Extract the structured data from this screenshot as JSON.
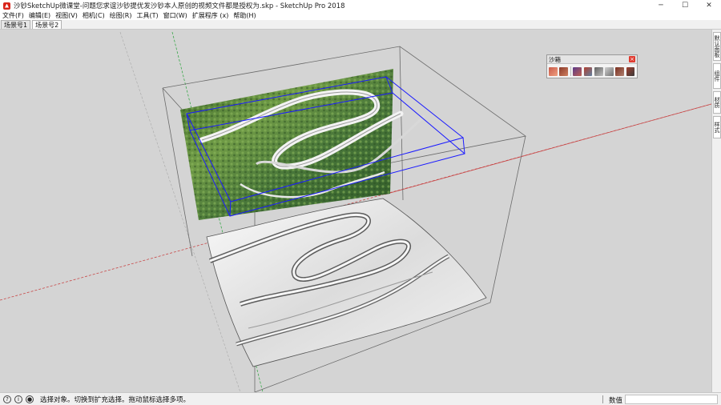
{
  "window": {
    "title": "沙钞SketchUp微课堂-问题您求谊沙钞提优发沙钞本人原创的视频文件都是授权为.skp - SketchUp Pro 2018",
    "minimize": "─",
    "maximize": "☐",
    "close": "✕"
  },
  "menu": [
    {
      "label": "文件(F)"
    },
    {
      "label": "编辑(E)"
    },
    {
      "label": "视图(V)"
    },
    {
      "label": "相机(C)"
    },
    {
      "label": "绘图(R)"
    },
    {
      "label": "工具(T)"
    },
    {
      "label": "窗口(W)"
    },
    {
      "label": "扩展程序 (x)"
    },
    {
      "label": "帮助(H)"
    }
  ],
  "scenes": [
    {
      "label": "场景号1",
      "active": false
    },
    {
      "label": "场景号2",
      "active": true
    }
  ],
  "right_tray": [
    {
      "label": "默认面板"
    },
    {
      "label": "组件"
    },
    {
      "label": "材质"
    },
    {
      "label": "样式"
    }
  ],
  "sandbox_toolbar": {
    "title": "沙箱",
    "close": "×",
    "tools": [
      {
        "icon": "sandbox-from-contours-icon"
      },
      {
        "icon": "sandbox-from-scratch-icon"
      },
      {
        "icon": "smoove-icon"
      },
      {
        "icon": "stamp-icon"
      },
      {
        "icon": "drape-icon"
      },
      {
        "icon": "add-detail-icon"
      },
      {
        "icon": "flip-edge-icon"
      },
      {
        "icon": "unknown-sandbox-tool-icon"
      }
    ]
  },
  "statusbar": {
    "hint": "选择对象。切换到扩充选择。拖动鼠标选择多项。",
    "vcb_label": "数值",
    "vcb_value": ""
  },
  "colors": {
    "viewport_bg": "#d4d4d4",
    "red_axis": "#c84848",
    "green_axis": "#3aa84a",
    "selection_blue": "#1a1aff"
  }
}
